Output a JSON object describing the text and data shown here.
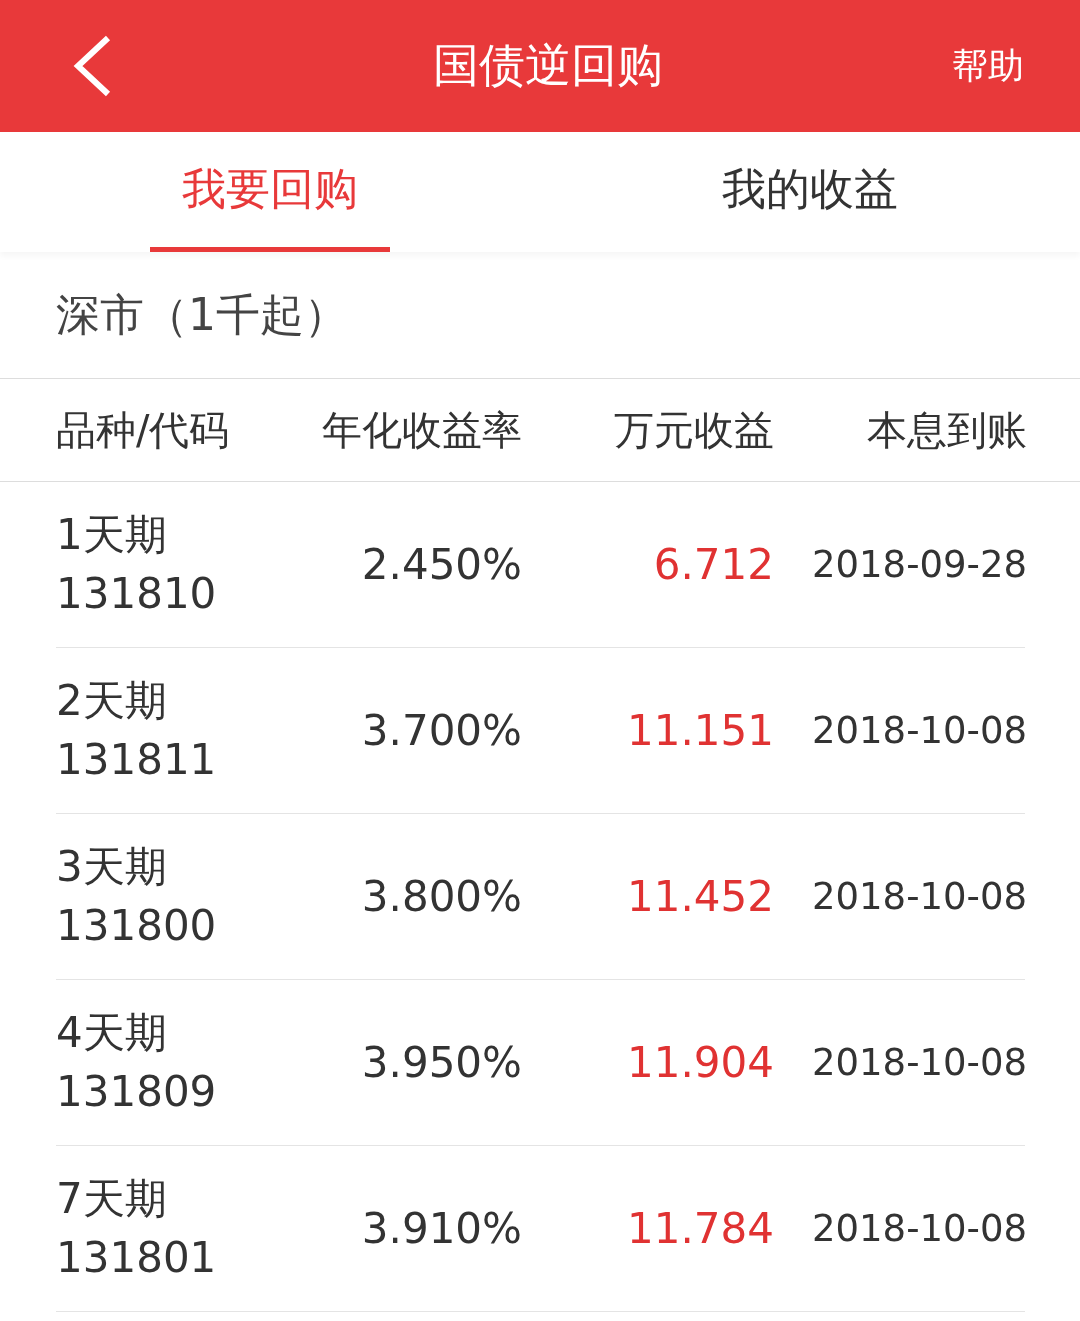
{
  "header": {
    "title": "国债逆回购",
    "help": "帮助"
  },
  "tabs": [
    {
      "label": "我要回购",
      "selected": true
    },
    {
      "label": "我的收益",
      "selected": false
    }
  ],
  "section": {
    "title": "深市（1千起）"
  },
  "table": {
    "columns": [
      "品种/代码",
      "年化收益率",
      "万元收益",
      "本息到账"
    ],
    "rows": [
      {
        "name": "1天期",
        "code": "131810",
        "rate": "2.450%",
        "income": "6.712",
        "date": "2018-09-28"
      },
      {
        "name": "2天期",
        "code": "131811",
        "rate": "3.700%",
        "income": "11.151",
        "date": "2018-10-08"
      },
      {
        "name": "3天期",
        "code": "131800",
        "rate": "3.800%",
        "income": "11.452",
        "date": "2018-10-08"
      },
      {
        "name": "4天期",
        "code": "131809",
        "rate": "3.950%",
        "income": "11.904",
        "date": "2018-10-08"
      },
      {
        "name": "7天期",
        "code": "131801",
        "rate": "3.910%",
        "income": "11.784",
        "date": "2018-10-08"
      }
    ]
  }
}
